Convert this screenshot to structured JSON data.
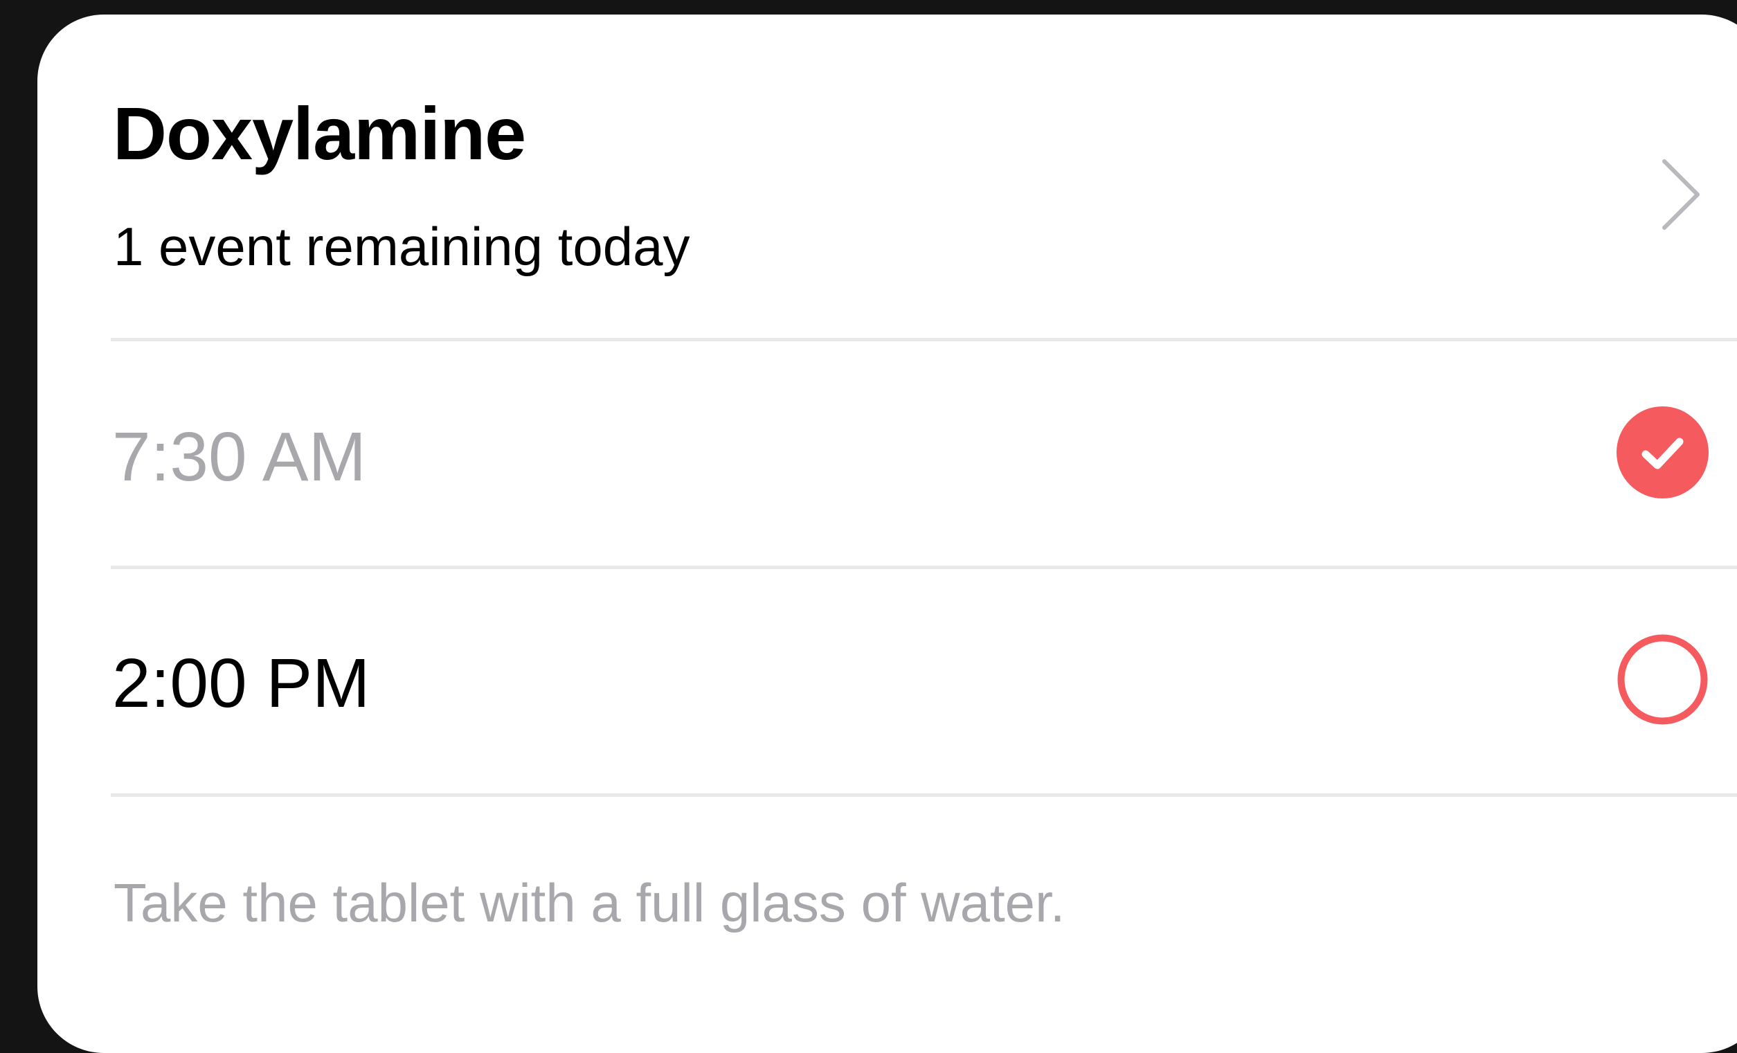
{
  "medication": {
    "name": "Doxylamine",
    "status": "1 event remaining today",
    "chevron_icon": "chevron-right-icon"
  },
  "events": [
    {
      "time": "7:30 AM",
      "taken": true,
      "status_icon": "checkmark-filled-circle-icon"
    },
    {
      "time": "2:00 PM",
      "taken": false,
      "status_icon": "empty-circle-icon"
    }
  ],
  "note": "Take the tablet with a full glass of water.",
  "colors": {
    "accent": "#f55a5e",
    "background": "#141414",
    "card": "#ffffff",
    "muted_text": "#a8a8ac",
    "divider": "#e9e9ec"
  }
}
